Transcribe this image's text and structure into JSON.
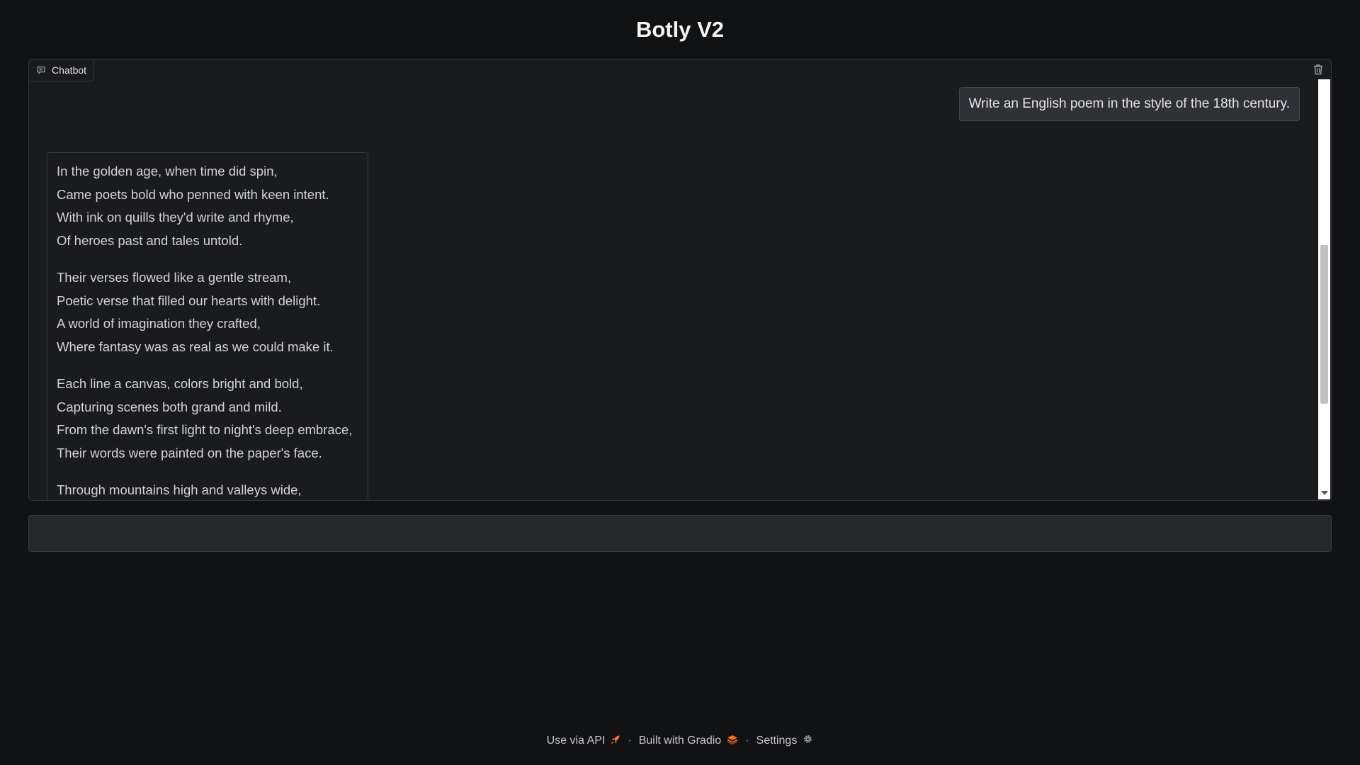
{
  "app": {
    "title": "Botly V2"
  },
  "chatbot": {
    "label": "Chatbot",
    "label_icon": "chat-bubble-icon",
    "clear_icon": "trash-icon",
    "messages": [
      {
        "role": "user",
        "text": "Write an English poem in the style of the 18th century."
      },
      {
        "role": "bot",
        "stanzas": [
          [
            "In the golden age, when time did spin,",
            "Came poets bold who penned with keen intent.",
            "With ink on quills they'd write and rhyme,",
            "Of heroes past and tales untold."
          ],
          [
            "Their verses flowed like a gentle stream,",
            "Poetic verse that filled our hearts with delight.",
            "A world of imagination they crafted,",
            "Where fantasy was as real as we could make it."
          ],
          [
            "Each line a canvas, colors bright and bold,",
            "Capturing scenes both grand and mild.",
            "From the dawn's first light to night's deep embrace,",
            "Their words were painted on the paper's face."
          ],
          [
            "Through mountains high and valleys wide,"
          ]
        ]
      }
    ]
  },
  "input": {
    "value": "",
    "placeholder": ""
  },
  "footer": {
    "api_label": "Use via API",
    "api_icon": "rocket-icon",
    "gradio_label": "Built with Gradio",
    "gradio_icon": "gradio-logo-icon",
    "settings_label": "Settings",
    "settings_icon": "gear-icon",
    "separator": "·"
  },
  "colors": {
    "background": "#111214",
    "panel": "#1a1b1e",
    "user_bubble": "#2f3136",
    "accent_orange": "#f97316"
  }
}
